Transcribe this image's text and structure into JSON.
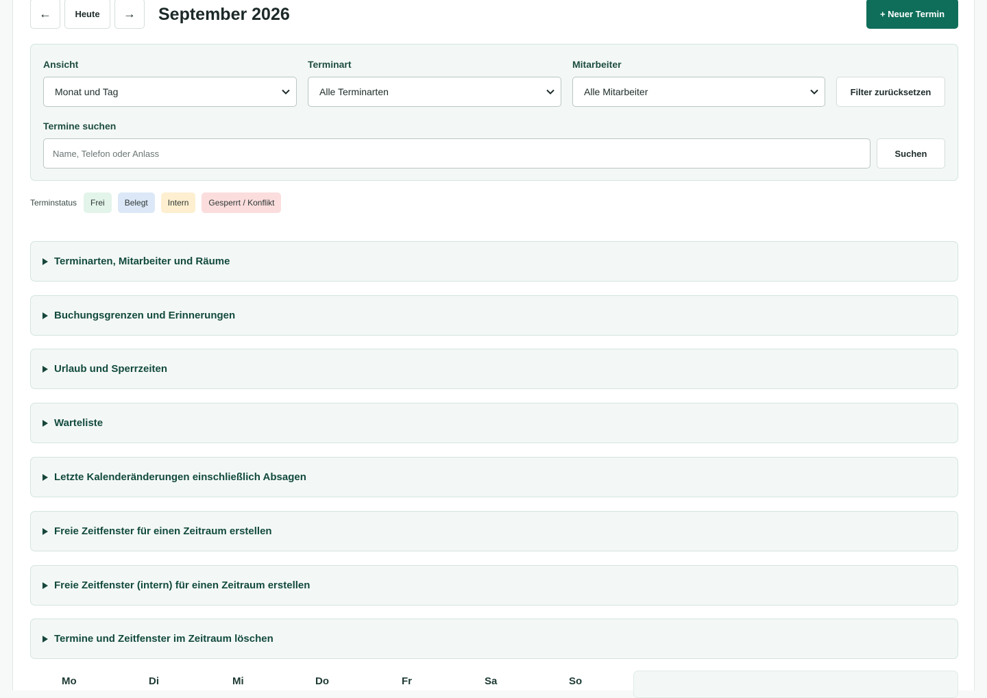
{
  "header": {
    "prev_label": "←",
    "today_label": "Heute",
    "next_label": "→",
    "month_title": "September 2026",
    "new_appointment_label": "+ Neuer Termin",
    "accent_color": "#0f6e5a"
  },
  "filters": {
    "view_label": "Ansicht",
    "view_value": "Monat und Tag",
    "type_label": "Terminart",
    "type_value": "Alle Terminarten",
    "staff_label": "Mitarbeiter",
    "staff_value": "Alle Mitarbeiter",
    "reset_label": "Filter zurücksetzen",
    "search_label": "Termine suchen",
    "search_placeholder": "Name, Telefon oder Anlass",
    "search_button_label": "Suchen"
  },
  "status_legend": {
    "label": "Terminstatus",
    "items": [
      {
        "label": "Frei",
        "color": "#e3f4ea"
      },
      {
        "label": "Belegt",
        "color": "#dce8f7"
      },
      {
        "label": "Intern",
        "color": "#fdefd0"
      },
      {
        "label": "Gesperrt / Konflikt",
        "color": "#fbdddd"
      }
    ]
  },
  "accordions": [
    {
      "title": "Terminarten, Mitarbeiter und Räume"
    },
    {
      "title": "Buchungsgrenzen und Erinnerungen"
    },
    {
      "title": "Urlaub und Sperrzeiten"
    },
    {
      "title": "Warteliste"
    },
    {
      "title": "Letzte Kalenderänderungen einschließlich Absagen"
    },
    {
      "title": "Freie Zeitfenster für einen Zeitraum erstellen"
    },
    {
      "title": "Freie Zeitfenster (intern) für einen Zeitraum erstellen"
    },
    {
      "title": "Termine und Zeitfenster im Zeitraum löschen"
    }
  ],
  "calendar": {
    "weekdays": [
      "Mo",
      "Di",
      "Mi",
      "Do",
      "Fr",
      "Sa",
      "So"
    ]
  }
}
